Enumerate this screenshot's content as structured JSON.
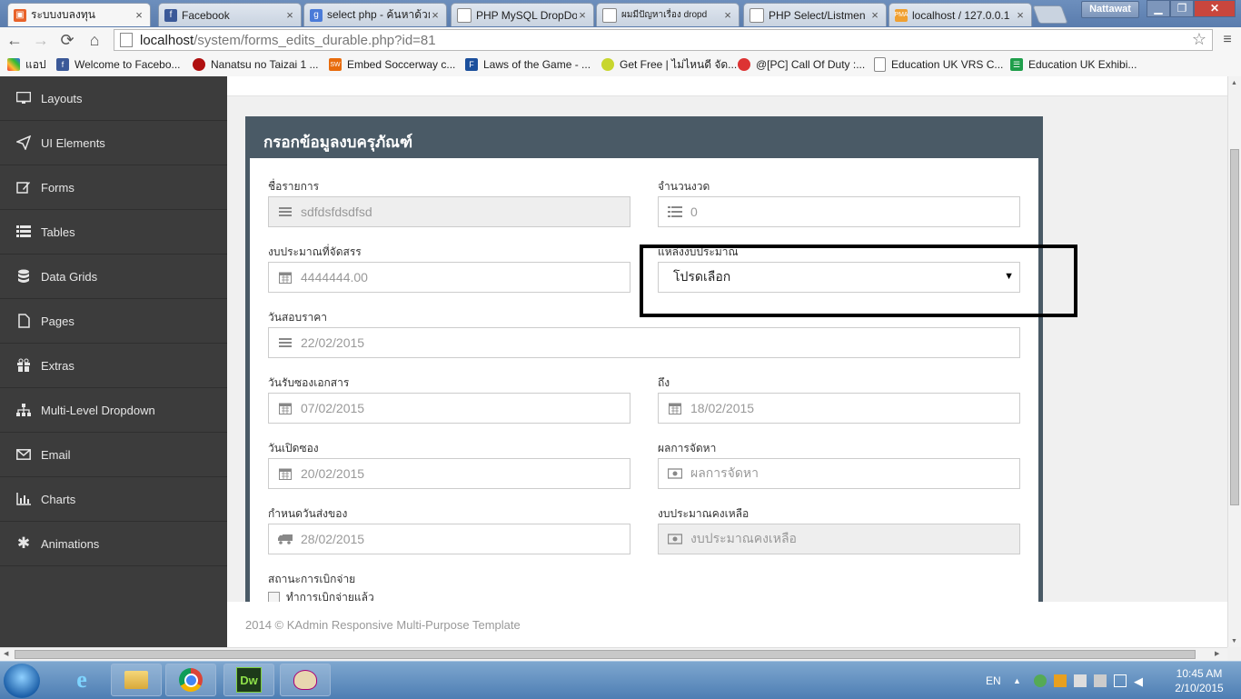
{
  "browser": {
    "tabs": [
      {
        "title": "ระบบงบลงทุน",
        "icon": "orange-square-icon",
        "active": true
      },
      {
        "title": "Facebook",
        "icon": "facebook-icon"
      },
      {
        "title": "select php - ค้นหาด้วย",
        "icon": "google-icon"
      },
      {
        "title": "PHP MySQL DropDo",
        "icon": "page-icon"
      },
      {
        "title": "ผมมีปัญหาเรื่อง dropd",
        "icon": "page-icon"
      },
      {
        "title": "PHP Select/Listmen",
        "icon": "page-icon"
      },
      {
        "title": "localhost / 127.0.0.1",
        "icon": "phpmyadmin-icon"
      }
    ],
    "profile": "Nattawat",
    "url_host": "localhost",
    "url_path": "/system/forms_edits_durable.php?id=81",
    "bookmarks": [
      {
        "label": "แอป",
        "icon": "apps-icon"
      },
      {
        "label": "Welcome to Facebo...",
        "icon": "facebook-icon"
      },
      {
        "label": "Nanatsu no Taizai 1 ...",
        "icon": "red-circle-icon"
      },
      {
        "label": "Embed Soccerway c...",
        "icon": "sw-icon"
      },
      {
        "label": "Laws of the Game - ...",
        "icon": "fifa-icon"
      },
      {
        "label": "Get Free | ไม่ไหนดี จัด...",
        "icon": "green-bird-icon"
      },
      {
        "label": "@[PC] Call Of Duty :...",
        "icon": "mascot-icon"
      },
      {
        "label": "Education UK VRS C...",
        "icon": "page-icon"
      },
      {
        "label": "Education UK Exhibi...",
        "icon": "sheets-icon"
      }
    ]
  },
  "sidebar": {
    "items": [
      {
        "label": "Layouts",
        "icon": "monitor-icon"
      },
      {
        "label": "UI Elements",
        "icon": "paper-plane-icon"
      },
      {
        "label": "Forms",
        "icon": "edit-icon"
      },
      {
        "label": "Tables",
        "icon": "list-icon"
      },
      {
        "label": "Data Grids",
        "icon": "database-icon"
      },
      {
        "label": "Pages",
        "icon": "file-icon"
      },
      {
        "label": "Extras",
        "icon": "gift-icon"
      },
      {
        "label": "Multi-Level Dropdown",
        "icon": "sitemap-icon"
      },
      {
        "label": "Email",
        "icon": "envelope-icon"
      },
      {
        "label": "Charts",
        "icon": "bar-chart-icon"
      },
      {
        "label": "Animations",
        "icon": "gear-icon"
      }
    ]
  },
  "form": {
    "title": "กรอกข้อมูลงบครุภัณฑ์",
    "item_name": {
      "label": "ชื่อรายการ",
      "value": "sdfdsfdsdfsd"
    },
    "installments": {
      "label": "จำนวนงวด",
      "value": "0"
    },
    "budget_allocated": {
      "label": "งบประมาณที่จัดสรร",
      "value": "4444444.00"
    },
    "budget_source": {
      "label": "แหล่งงบประมาณ",
      "selected": "โปรดเลือก"
    },
    "price_check_date": {
      "label": "วันสอบราคา",
      "value": "22/02/2015"
    },
    "doc_receive_date": {
      "label": "วันรับซองเอกสาร",
      "value": "07/02/2015"
    },
    "doc_receive_to": {
      "label": "ถึง",
      "value": "18/02/2015"
    },
    "envelope_open_date": {
      "label": "วันเปิดซอง",
      "value": "20/02/2015"
    },
    "procurement_result": {
      "label": "ผลการจัดหา",
      "placeholder": "ผลการจัดหา"
    },
    "delivery_date": {
      "label": "กำหนดวันส่งของ",
      "value": "28/02/2015"
    },
    "budget_remaining": {
      "label": "งบประมาณคงเหลือ",
      "placeholder": "งบประมาณคงเหลือ"
    },
    "disbursement_status": {
      "label": "สถานะการเบิกจ่าย",
      "checkbox_label": "ทำการเบิกจ่ายแล้ว"
    }
  },
  "footer": {
    "text": "2014 © KAdmin Responsive Multi-Purpose Template"
  },
  "taskbar": {
    "apps": [
      "ie-icon",
      "explorer-icon",
      "chrome-icon",
      "dreamweaver-icon",
      "paint-icon"
    ],
    "dreamweaver_label": "Dw",
    "language": "EN",
    "time": "10:45 AM",
    "date": "2/10/2015"
  }
}
